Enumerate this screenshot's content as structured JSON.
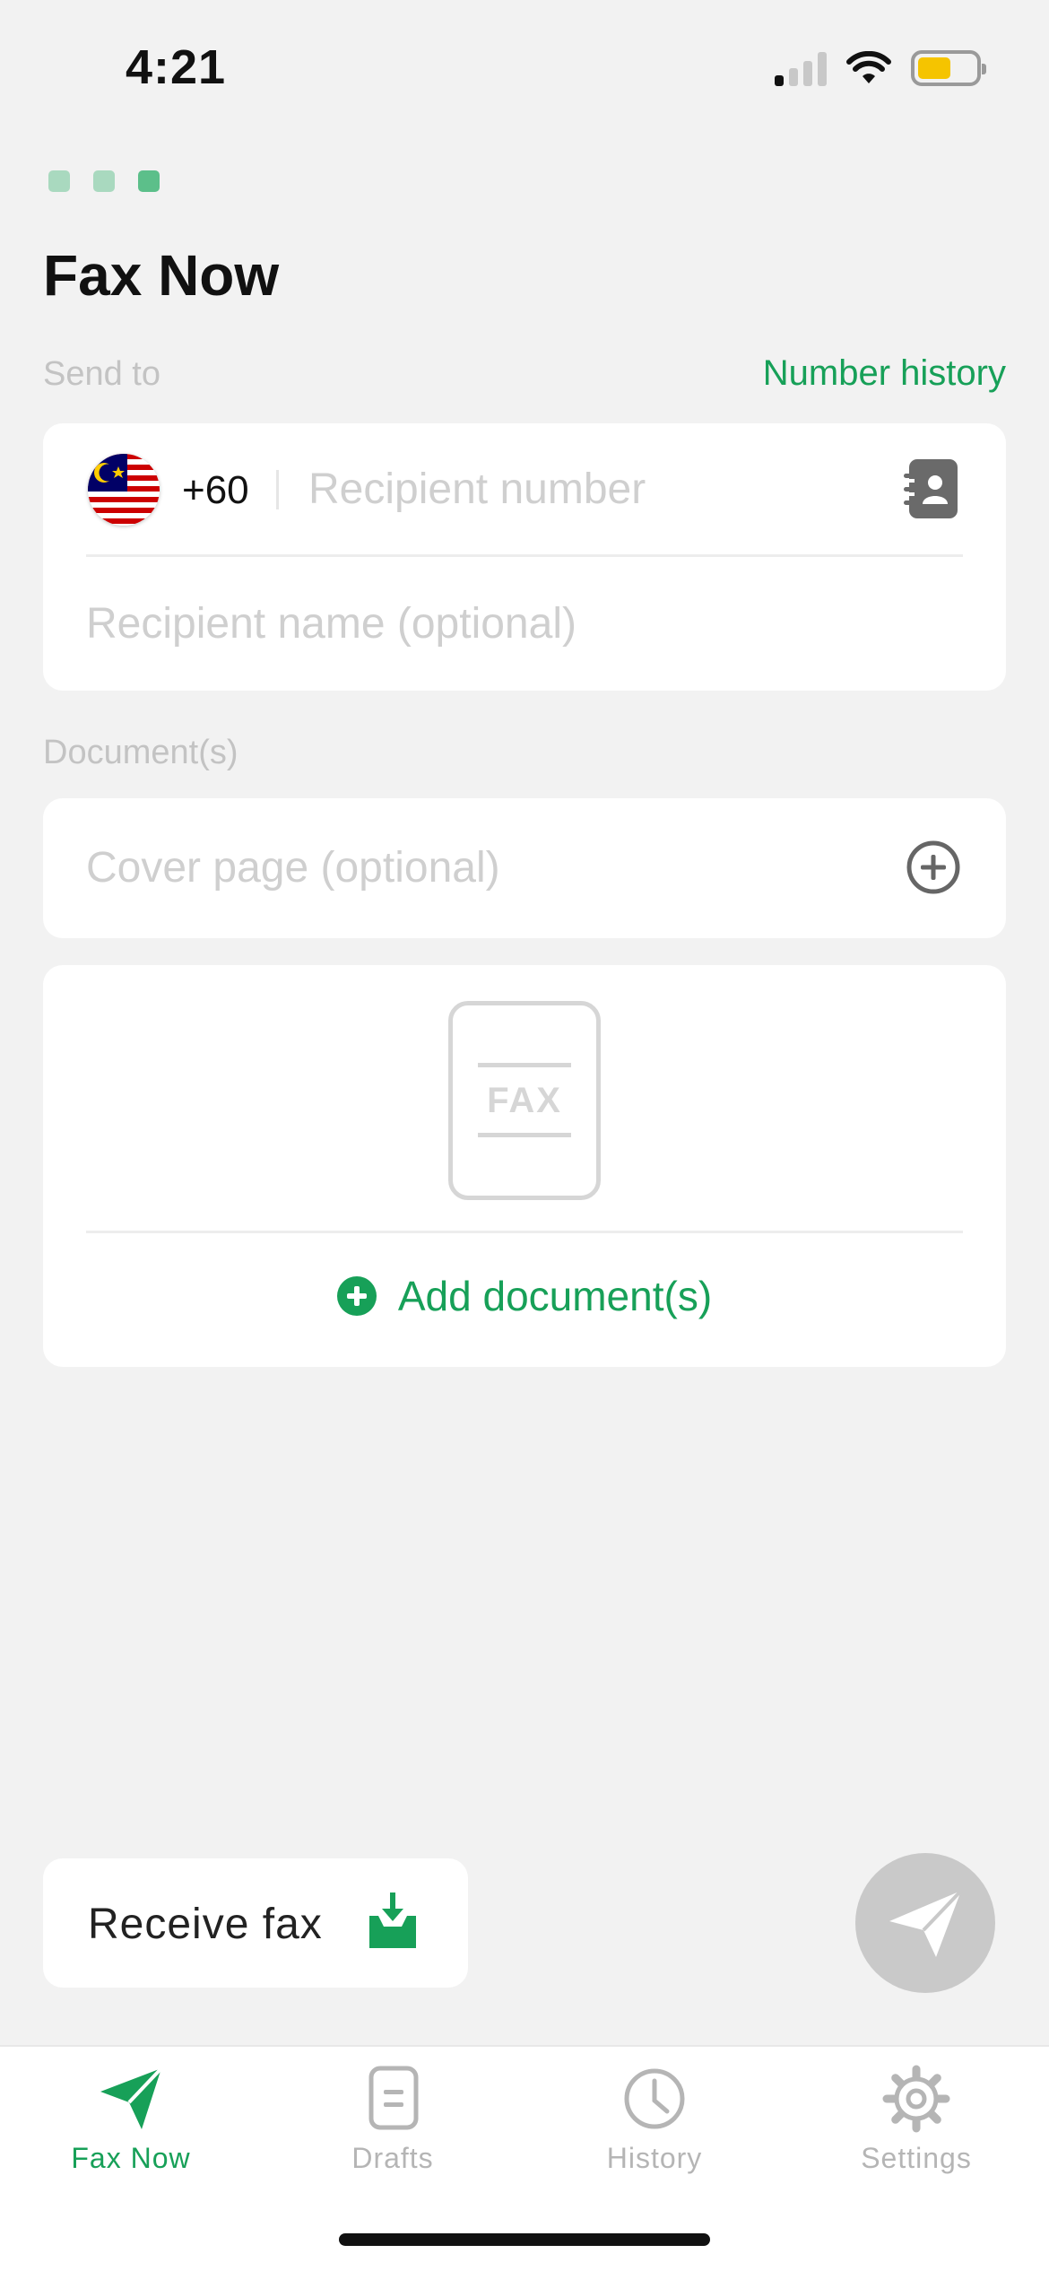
{
  "status_bar": {
    "time": "4:21"
  },
  "header": {
    "title": "Fax Now",
    "loader_colors": [
      "#a9d9bf",
      "#a9d9bf",
      "#5cbf8a"
    ]
  },
  "recipient": {
    "section_label": "Send to",
    "number_history_link": "Number history",
    "country_flag": "malaysia-flag",
    "country_code": "+60",
    "number_placeholder": "Recipient number",
    "name_placeholder": "Recipient name (optional)"
  },
  "documents": {
    "section_label": "Document(s)",
    "cover_page_placeholder": "Cover page (optional)",
    "fax_icon_text": "FAX",
    "add_document_label": "Add document(s)"
  },
  "actions": {
    "receive_fax_label": "Receive fax",
    "send_button_icon": "paper-plane-icon"
  },
  "tabbar": {
    "tabs": [
      {
        "label": "Fax Now",
        "icon": "paper-plane-icon",
        "active": true
      },
      {
        "label": "Drafts",
        "icon": "document-icon",
        "active": false
      },
      {
        "label": "History",
        "icon": "clock-icon",
        "active": false
      },
      {
        "label": "Settings",
        "icon": "gear-icon",
        "active": false
      }
    ]
  },
  "colors": {
    "accent": "#17a058",
    "inactive": "#b5b5b5",
    "background": "#f2f2f2"
  }
}
